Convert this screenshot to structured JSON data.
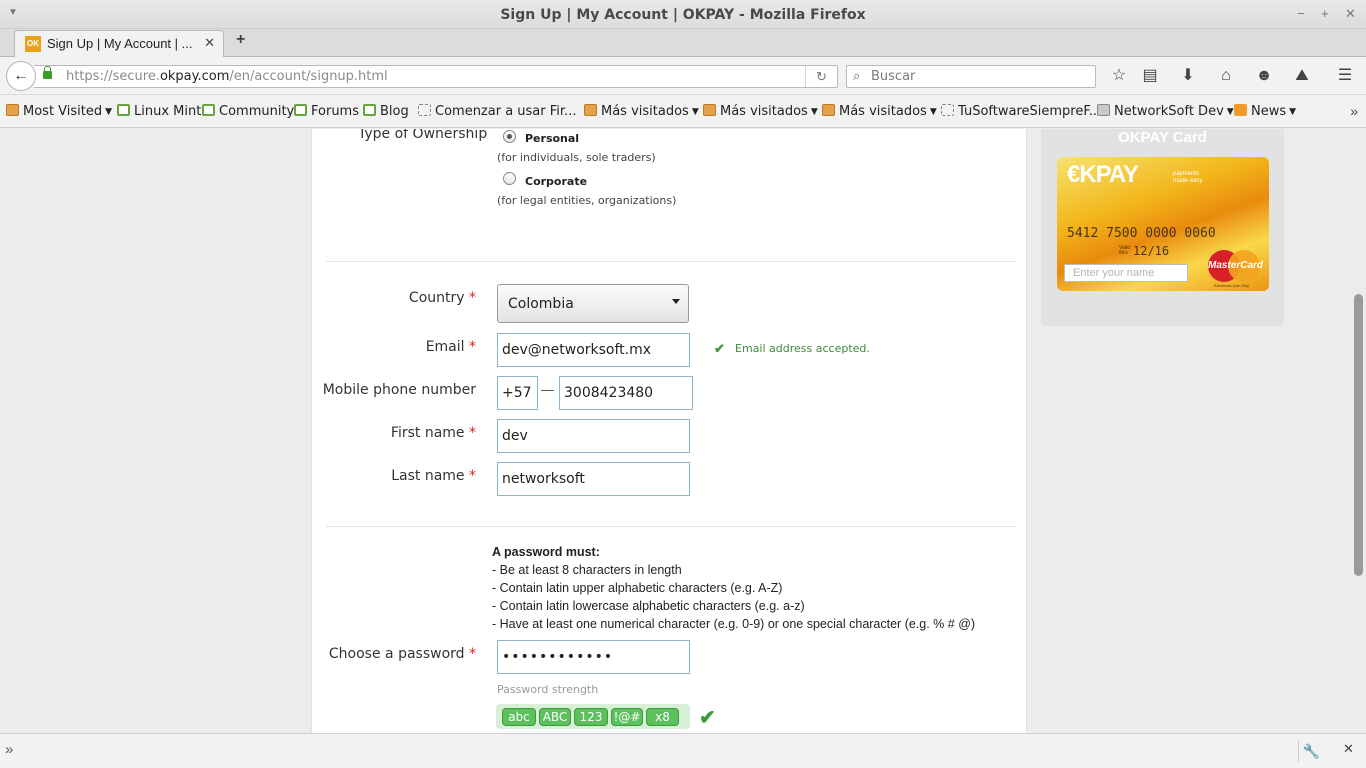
{
  "window": {
    "title": "Sign Up | My Account | OKPAY - Mozilla Firefox"
  },
  "tab": {
    "title": "Sign Up | My Account | ...",
    "favicon_text": "OK"
  },
  "navbar": {
    "url_prefix": "https://secure.",
    "url_domain": "okpay.com",
    "url_path": "/en/account/signup.html",
    "search_placeholder": "Buscar",
    "icons": [
      "back-icon",
      "reload-icon",
      "search-icon",
      "star-icon",
      "reading-list-icon",
      "download-icon",
      "home-icon",
      "chat-icon",
      "account-icon",
      "menu-icon"
    ]
  },
  "bookmarks": [
    {
      "label": "Most Visited",
      "icon": "folder",
      "dropdown": true
    },
    {
      "label": "Linux Mint",
      "icon": "mint",
      "dropdown": false
    },
    {
      "label": "Community",
      "icon": "mint",
      "dropdown": false
    },
    {
      "label": "Forums",
      "icon": "mint",
      "dropdown": false
    },
    {
      "label": "Blog",
      "icon": "mint",
      "dropdown": false
    },
    {
      "label": "Comenzar a usar Fir...",
      "icon": "blank",
      "dropdown": false
    },
    {
      "label": "Más visitados",
      "icon": "folder",
      "dropdown": true
    },
    {
      "label": "Más visitados",
      "icon": "folder",
      "dropdown": true
    },
    {
      "label": "Más visitados",
      "icon": "folder",
      "dropdown": true
    },
    {
      "label": "TuSoftwareSiempreF...",
      "icon": "blank",
      "dropdown": false
    },
    {
      "label": "NetworkSoft Dev",
      "icon": "gray",
      "dropdown": true
    },
    {
      "label": "News",
      "icon": "rss",
      "dropdown": true
    }
  ],
  "form": {
    "ownership_label": "Type of Ownership",
    "personal_label": "Personal",
    "personal_desc": "(for individuals, sole traders)",
    "corporate_label": "Corporate",
    "corporate_desc": "(for legal entities, organizations)",
    "ownership_selected": "Personal",
    "country_label": "Country",
    "country_value": "Colombia",
    "email_label": "Email",
    "email_value": "dev@networksoft.mx",
    "email_status": "Email address accepted.",
    "mobile_label": "Mobile phone number",
    "mobile_code": "+57",
    "mobile_dash": "—",
    "mobile_number": "3008423480",
    "first_name_label": "First name",
    "first_name_value": "dev",
    "last_name_label": "Last name",
    "last_name_value": "networksoft",
    "required_mark": "*",
    "password_rules_head": "A password must:",
    "password_rules": [
      "- Be at least 8 characters in length",
      "- Contain latin upper alphabetic characters (e.g. A-Z)",
      "- Contain latin lowercase alphabetic characters (e.g. a-z)",
      "- Have at least one numerical character (e.g. 0-9) or one special character (e.g. % # @)"
    ],
    "password_label": "Choose a password",
    "password_value": "••••••••••••",
    "strength_label": "Password strength",
    "strength_chips": [
      "abc",
      "ABC",
      "123",
      "!@#",
      "x8"
    ]
  },
  "card": {
    "title": "OKPAY Card",
    "logo": "€KPAY",
    "tagline_1": "payments",
    "tagline_2": "made easy",
    "number": "5412 7500  0000  0060",
    "valid_1": "Valid",
    "valid_2": "thru",
    "expiry": "12/16",
    "name_placeholder": "Enter your name",
    "brand": "MasterCard",
    "electronic": "Electronic Use Only"
  },
  "colors": {
    "accent": "#e9a21a",
    "success": "#3d9a3d",
    "required": "#dd2222"
  }
}
